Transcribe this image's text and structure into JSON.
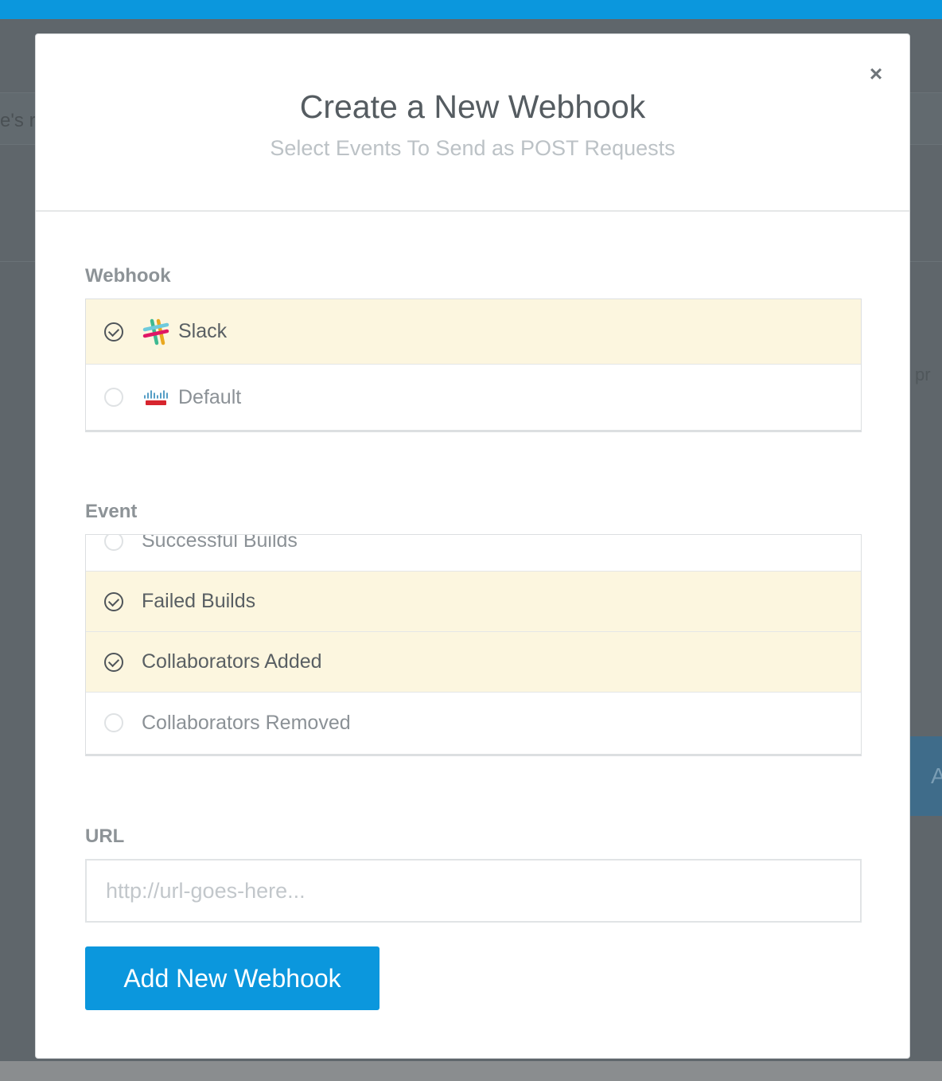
{
  "background": {
    "fragment_left": "e's r",
    "fragment_right": "pr",
    "fragment_button": "A"
  },
  "modal": {
    "title": "Create a New Webhook",
    "subtitle": "Select Events To Send as POST Requests",
    "close_label": "×"
  },
  "webhook": {
    "label": "Webhook",
    "options": [
      {
        "label": "Slack",
        "selected": true,
        "icon": "slack-icon"
      },
      {
        "label": "Default",
        "selected": false,
        "icon": "cisco-icon"
      }
    ]
  },
  "event": {
    "label": "Event",
    "options": [
      {
        "label": "Successful Builds",
        "selected": false
      },
      {
        "label": "Failed Builds",
        "selected": true
      },
      {
        "label": "Collaborators Added",
        "selected": true
      },
      {
        "label": "Collaborators Removed",
        "selected": false
      }
    ]
  },
  "url": {
    "label": "URL",
    "placeholder": "http://url-goes-here...",
    "value": ""
  },
  "submit": {
    "label": "Add New Webhook"
  },
  "colors": {
    "accent": "#0b97dd",
    "selected_row": "#fcf6df",
    "overlay": "#5f666b"
  }
}
